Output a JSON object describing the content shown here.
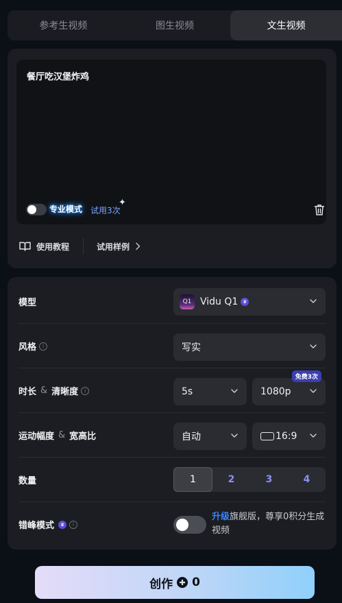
{
  "tabs": [
    {
      "label": "参考生视频",
      "active": false
    },
    {
      "label": "图生视频",
      "active": false
    },
    {
      "label": "文生视频",
      "active": true
    }
  ],
  "prompt": {
    "text": "餐厅吃汉堡炸鸡",
    "pro_mode_label": "专业模式",
    "trial_label": "试用3次",
    "sparkle": "✦"
  },
  "tools": {
    "tutorial_label": "使用教程",
    "examples_label": "试用样例"
  },
  "settings": {
    "model": {
      "label": "模型",
      "value": "Vidu Q1",
      "icon_text": "Q1"
    },
    "style": {
      "label": "风格",
      "value": "写实"
    },
    "duration_resolution": {
      "label_a": "时长",
      "amp": "&",
      "label_b": "清晰度",
      "duration": "5s",
      "resolution": "1080p",
      "badge": "免费3次"
    },
    "motion_ratio": {
      "label_a": "运动幅度",
      "amp": "&",
      "label_b": "宽高比",
      "motion": "自动",
      "ratio": "16:9"
    },
    "quantity": {
      "label": "数量",
      "options": [
        "1",
        "2",
        "3",
        "4"
      ],
      "selected": "1"
    },
    "off_peak": {
      "label": "错峰模式",
      "upgrade": "升级",
      "upgrade_text": "旗舰版，尊享0积分生成视频",
      "enabled": false
    }
  },
  "create_button": {
    "label": "创作",
    "cost": "0"
  },
  "colors": {
    "accent": "#3b82f6",
    "background": "#0b0f16",
    "card": "#1b1d22"
  }
}
